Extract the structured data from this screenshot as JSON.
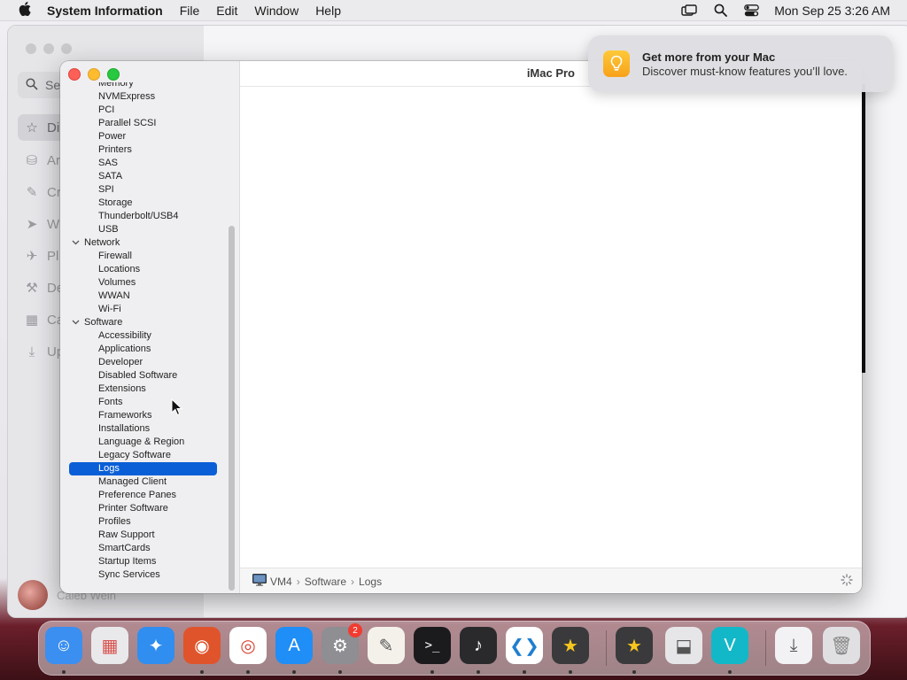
{
  "menubar": {
    "app_name": "System Information",
    "items": [
      "File",
      "Edit",
      "Window",
      "Help"
    ],
    "clock": "Mon Sep 25  3:26 AM"
  },
  "bg_window": {
    "search_placeholder": "Se",
    "nav": [
      "Di",
      "Ar",
      "Cr",
      "W",
      "Pl",
      "De",
      "Ca",
      "Up"
    ],
    "user_name": "Caleb Wein"
  },
  "window": {
    "title": "iMac Pro"
  },
  "tree": [
    {
      "label": "Memory",
      "level": 2
    },
    {
      "label": "NVMExpress",
      "level": 2
    },
    {
      "label": "PCI",
      "level": 2
    },
    {
      "label": "Parallel SCSI",
      "level": 2
    },
    {
      "label": "Power",
      "level": 2
    },
    {
      "label": "Printers",
      "level": 2
    },
    {
      "label": "SAS",
      "level": 2
    },
    {
      "label": "SATA",
      "level": 2
    },
    {
      "label": "SPI",
      "level": 2
    },
    {
      "label": "Storage",
      "level": 2
    },
    {
      "label": "Thunderbolt/USB4",
      "level": 2
    },
    {
      "label": "USB",
      "level": 2
    },
    {
      "label": "Network",
      "level": 1
    },
    {
      "label": "Firewall",
      "level": 2
    },
    {
      "label": "Locations",
      "level": 2
    },
    {
      "label": "Volumes",
      "level": 2
    },
    {
      "label": "WWAN",
      "level": 2
    },
    {
      "label": "Wi-Fi",
      "level": 2
    },
    {
      "label": "Software",
      "level": 1
    },
    {
      "label": "Accessibility",
      "level": 2
    },
    {
      "label": "Applications",
      "level": 2
    },
    {
      "label": "Developer",
      "level": 2
    },
    {
      "label": "Disabled Software",
      "level": 2
    },
    {
      "label": "Extensions",
      "level": 2
    },
    {
      "label": "Fonts",
      "level": 2
    },
    {
      "label": "Frameworks",
      "level": 2
    },
    {
      "label": "Installations",
      "level": 2
    },
    {
      "label": "Language & Region",
      "level": 2
    },
    {
      "label": "Legacy Software",
      "level": 2
    },
    {
      "label": "Logs",
      "level": 2,
      "selected": true
    },
    {
      "label": "Managed Client",
      "level": 2
    },
    {
      "label": "Preference Panes",
      "level": 2
    },
    {
      "label": "Printer Software",
      "level": 2
    },
    {
      "label": "Profiles",
      "level": 2
    },
    {
      "label": "Raw Support",
      "level": 2
    },
    {
      "label": "SmartCards",
      "level": 2
    },
    {
      "label": "Startup Items",
      "level": 2
    },
    {
      "label": "Sync Services",
      "level": 2
    }
  ],
  "pathbar": {
    "segments": [
      "VM4",
      "Software",
      "Logs"
    ]
  },
  "notification": {
    "title": "Get more from your Mac",
    "body": "Discover must-know features you’ll love."
  },
  "dock": {
    "apps": [
      {
        "name": "Finder",
        "icon": "finder-icon",
        "color": "#3b8ff0"
      },
      {
        "name": "Launchpad",
        "icon": "launchpad-icon",
        "color": "#e9e9ec"
      },
      {
        "name": "Safari",
        "icon": "safari-icon",
        "color": "#2f8ef0"
      },
      {
        "name": "Firefox",
        "icon": "firefox-icon",
        "color": "#e0542b"
      },
      {
        "name": "Chrome",
        "icon": "chrome-icon",
        "color": "#ffffff"
      },
      {
        "name": "App Store",
        "icon": "app-store-icon",
        "color": "#1f8ef7"
      },
      {
        "name": "System Settings",
        "icon": "gear-icon",
        "color": "#8e8e93",
        "badge": "2"
      },
      {
        "name": "TextEdit",
        "icon": "textedit-icon",
        "color": "#f4f1ea"
      },
      {
        "name": "Terminal",
        "icon": "terminal-icon",
        "color": "#1b1b1d"
      },
      {
        "name": "GarageBand",
        "icon": "guitar-icon",
        "color": "#2a2a2c"
      },
      {
        "name": "VS Code",
        "icon": "vscode-icon",
        "color": "#ffffff"
      },
      {
        "name": "iMovie",
        "icon": "star-icon",
        "color": "#3a3a3c"
      },
      {
        "name": "iMovie 2",
        "icon": "star-icon",
        "color": "#3a3a3c"
      },
      {
        "name": "Archive Utility",
        "icon": "archive-icon",
        "color": "#e6e6e8"
      },
      {
        "name": "Vectorize",
        "icon": "v-icon",
        "color": "#13b8c8"
      },
      {
        "name": "Downloads",
        "icon": "downloads-icon",
        "color": "#f2f2f4"
      },
      {
        "name": "Trash",
        "icon": "trash-icon",
        "color": "#e0e0e3"
      }
    ]
  }
}
